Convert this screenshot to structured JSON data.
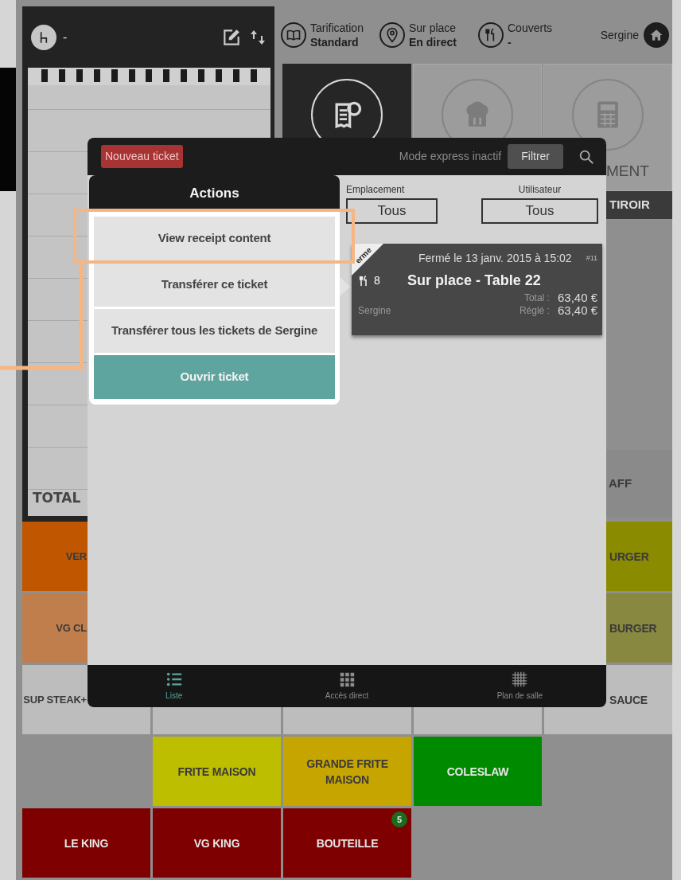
{
  "left_panel": {
    "table": "-",
    "total_label": "TOTAL"
  },
  "header": {
    "items": [
      {
        "kind": "pricing",
        "label": "Tarification",
        "value": "Standard"
      },
      {
        "kind": "place",
        "label": "Sur place",
        "value": "En direct"
      },
      {
        "kind": "covers",
        "label": "Couverts",
        "value": "-"
      }
    ],
    "user": "Sergine"
  },
  "modes": [
    {
      "kind": "ticket",
      "selected": true
    },
    {
      "kind": "kitchen",
      "selected": false
    },
    {
      "kind": "payment",
      "selected": false,
      "label": "MENT"
    }
  ],
  "drawer_button": {
    "label": "TIROIR"
  },
  "side_tile": {
    "label": "AFF",
    "color": "#8a8a8a"
  },
  "products": [
    [
      {
        "kind": "product",
        "text": "VER",
        "color": "#c05600"
      },
      {
        "kind": "hidden"
      },
      {
        "kind": "hidden"
      },
      {
        "kind": "hidden"
      },
      {
        "kind": "product",
        "text": "URGER",
        "color": "#8b8b00"
      }
    ],
    [
      {
        "kind": "product",
        "text": "VG CL",
        "color": "#c07e4c"
      },
      {
        "kind": "hidden"
      },
      {
        "kind": "hidden"
      },
      {
        "kind": "hidden"
      },
      {
        "kind": "product",
        "text": "BURGER",
        "color": "#888840"
      }
    ],
    [
      {
        "kind": "product",
        "text": "SUP STEAK+",
        "color": "#bdbdbd"
      },
      {
        "kind": "blank",
        "color": "#bdbdbd"
      },
      {
        "kind": "blank",
        "color": "#bdbdbd"
      },
      {
        "kind": "blank",
        "color": "#bdbdbd"
      },
      {
        "kind": "product",
        "text": "SAUCE",
        "color": "#bdbdbd"
      }
    ],
    [
      {
        "kind": "empty"
      },
      {
        "kind": "product",
        "text": "FRITE MAISON",
        "color": "#bebe00"
      },
      {
        "kind": "product",
        "text": "GRANDE FRITE MAISON",
        "color": "#c7a500"
      },
      {
        "kind": "product",
        "text": "COLESLAW",
        "color": "#008a00"
      },
      {
        "kind": "empty"
      }
    ],
    [
      {
        "kind": "product",
        "text": "LE KING",
        "color": "#7e0000"
      },
      {
        "kind": "product",
        "text": "VG KING",
        "color": "#7e0000"
      },
      {
        "kind": "product",
        "text": "BOUTEILLE",
        "color": "#7e0000",
        "badge": "5"
      },
      {
        "kind": "empty"
      },
      {
        "kind": "empty"
      }
    ]
  ],
  "ticket_dialog": {
    "new_ticket": "Nouveau ticket",
    "express_mode": "Mode express inactif",
    "filter_button": "Filtrer",
    "filters": [
      {
        "label": "Emplacement",
        "value": "Tous"
      },
      {
        "label": "Utilisateur",
        "value": "Tous"
      }
    ],
    "tickets": [
      {
        "status": "erme",
        "closed_at": "Fermé le 13 janv. 2015 à 15:02",
        "number": "#11",
        "covers": "8",
        "title": "Sur place - Table 22",
        "total_label": "Total :",
        "total": "63,40 €",
        "user": "Sergine",
        "paid_label": "Réglé :",
        "paid": "63,40 €"
      }
    ],
    "nav": [
      {
        "kind": "list",
        "label": "Liste",
        "selected": true
      },
      {
        "kind": "direct",
        "label": "Accès direct",
        "selected": false
      },
      {
        "kind": "floor",
        "label": "Plan de salle",
        "selected": false
      }
    ]
  },
  "actions_menu": {
    "title": "Actions",
    "items": [
      {
        "kind": "option",
        "label": "View receipt content",
        "callout": true
      },
      {
        "kind": "option",
        "label": "Transférer ce ticket",
        "callout": false
      },
      {
        "kind": "option",
        "label": "Transférer tous les tickets de Sergine",
        "callout": false
      },
      {
        "kind": "primary",
        "label": "Ouvrir ticket",
        "callout": false
      }
    ]
  }
}
